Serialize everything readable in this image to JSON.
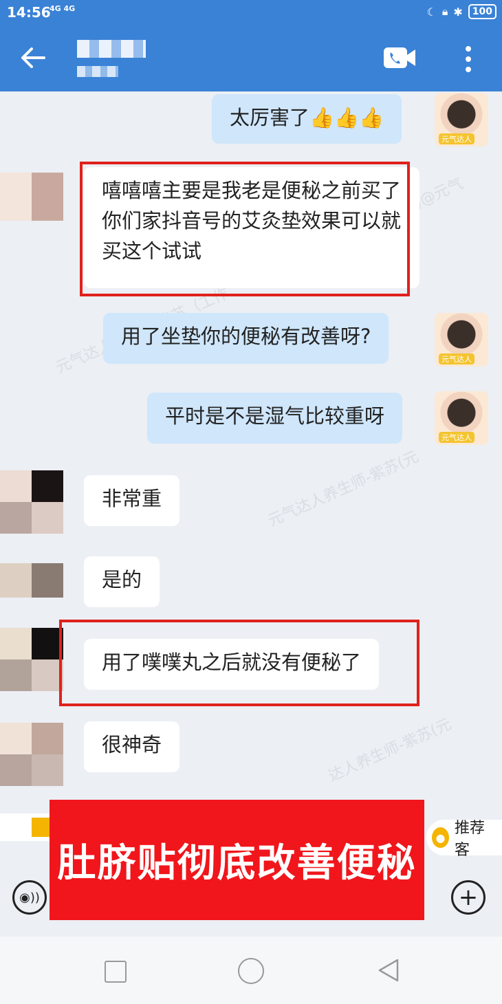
{
  "status_bar": {
    "time": "14:56",
    "network": "4G 4G",
    "battery": "100"
  },
  "header": {
    "back_icon": "arrow-left-icon",
    "video_call_icon": "video-call-icon",
    "more_icon": "more-vertical-icon"
  },
  "messages": [
    {
      "side": "out",
      "text": "太厉害了👍👍👍"
    },
    {
      "side": "in",
      "text": "嘻嘻嘻主要是我老是便秘之前买了你们家抖音号的艾灸垫效果可以就买这个试试"
    },
    {
      "side": "out",
      "text": "用了坐垫你的便秘有改善呀?"
    },
    {
      "side": "out",
      "text": "平时是不是湿气比较重呀"
    },
    {
      "side": "in",
      "text": "非常重"
    },
    {
      "side": "in",
      "text": "是的"
    },
    {
      "side": "in",
      "text": "用了噗噗丸之后就没有便秘了"
    },
    {
      "side": "in",
      "text": "很神奇"
    }
  ],
  "avatar_tag": "元气达人",
  "watermarks": [
    "元气达人养生师-紫苏（工作",
    "元气达人养生师-紫苏(元",
    "达人养生师-紫苏(元",
    ")@元气"
  ],
  "recommend_button": "推荐客",
  "banner_text": "肚脐贴彻底改善便秘",
  "colors": {
    "header_bg": "#3a82d6",
    "outgoing_bubble": "#cfe6fb",
    "incoming_bubble": "#ffffff",
    "highlight_red": "#e0211c",
    "banner_red": "#f0161b"
  }
}
